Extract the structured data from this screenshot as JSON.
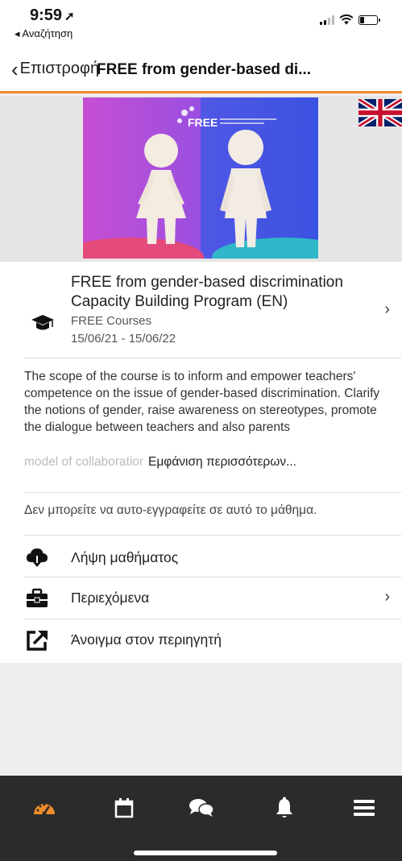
{
  "status_bar": {
    "time": "9:59",
    "location_arrow": "location-arrow-icon",
    "back_app": "◂ Αναζήτηση"
  },
  "nav": {
    "back_label": "Επιστροφή",
    "title": "FREE from gender-based di..."
  },
  "hero": {
    "image_text": "FREE",
    "flag": "uk-flag-icon"
  },
  "course": {
    "title": "FREE from gender-based discrimination Capacity Building Program (EN)",
    "category": "FREE Courses",
    "dates": "15/06/21 - 15/06/22",
    "icon": "graduation-cap-icon"
  },
  "description": {
    "text": "The scope of the course is to inform and empower teachers' competence on the issue of gender-based discrimination. Clarify the notions of gender, raise awareness on stereotypes, promote the dialogue between teachers and also parents",
    "faded_text": "model of collaboration bet",
    "more_label": "Εμφάνιση περισσότερων..."
  },
  "enrol_message": "Δεν μπορείτε να αυτο-εγγραφείτε σε αυτό το μάθημα.",
  "actions": [
    {
      "label": "Λήψη μαθήματος",
      "icon": "cloud-download-icon"
    },
    {
      "label": "Περιεχόμενα",
      "icon": "briefcase-icon"
    },
    {
      "label": "Άνοιγμα στον περιηγητή",
      "icon": "external-link-icon"
    }
  ],
  "tabs": [
    {
      "name": "dashboard",
      "icon": "dashboard-icon",
      "active": true
    },
    {
      "name": "calendar",
      "icon": "calendar-icon",
      "active": false
    },
    {
      "name": "messages",
      "icon": "chat-bubbles-icon",
      "active": false
    },
    {
      "name": "notifications",
      "icon": "bell-icon",
      "active": false
    },
    {
      "name": "menu",
      "icon": "hamburger-menu-icon",
      "active": false
    }
  ],
  "colors": {
    "accent": "#f18b2c",
    "tab_bar": "#2b2b2b"
  }
}
